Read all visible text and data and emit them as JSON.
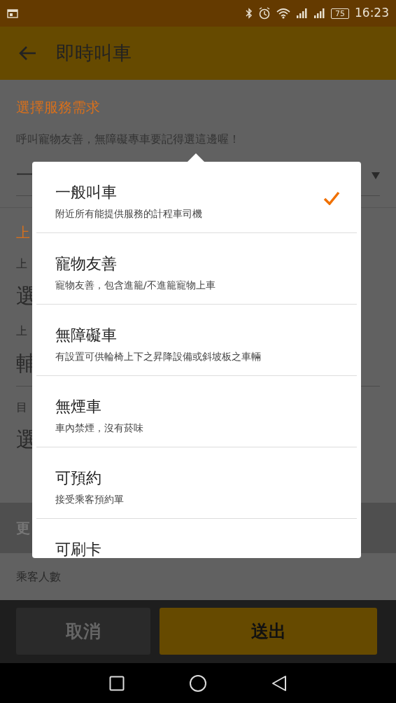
{
  "status_bar": {
    "battery": "75",
    "time": "16:23"
  },
  "app_bar": {
    "title": "即時叫車"
  },
  "service": {
    "section_title": "選擇服務需求",
    "hint": "呼叫寵物友善，無障礙專車要記得選這邊喔！",
    "value": "一"
  },
  "covered_texts": [
    {
      "kind": "heading",
      "text": "上"
    },
    {
      "kind": "label",
      "text": "上"
    },
    {
      "kind": "value",
      "text": "選"
    },
    {
      "kind": "label",
      "text": "上"
    },
    {
      "kind": "value",
      "text": "輔"
    },
    {
      "kind": "divider"
    },
    {
      "kind": "label",
      "text": "目"
    },
    {
      "kind": "value",
      "text": "選"
    }
  ],
  "more_section": {
    "title": "更"
  },
  "passengers": {
    "label": "乘客人數"
  },
  "options": [
    {
      "title": "一般叫車",
      "description": "附近所有能提供服務的計程車司機",
      "selected": true
    },
    {
      "title": "寵物友善",
      "description": "寵物友善，包含進籠/不進籠寵物上車",
      "selected": false
    },
    {
      "title": "無障礙車",
      "description": "有設置可供輪椅上下之昇降設備或斜坡板之車輛",
      "selected": false
    },
    {
      "title": "無煙車",
      "description": "車內禁煙，沒有菸味",
      "selected": false
    },
    {
      "title": "可預約",
      "description": "接受乘客預約單",
      "selected": false
    },
    {
      "title": "可刷卡",
      "selected": false
    }
  ],
  "buttons": [
    {
      "kind": "cancel",
      "label": "取消"
    },
    {
      "kind": "submit",
      "label": "送出"
    }
  ]
}
